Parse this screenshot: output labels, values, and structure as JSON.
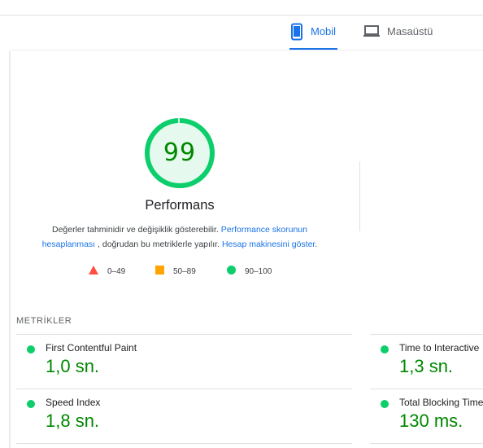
{
  "tabs": [
    {
      "label": "Mobil",
      "icon": "smartphone-icon",
      "selected": true
    },
    {
      "label": "Masaüstü",
      "icon": "laptop-icon",
      "selected": false
    }
  ],
  "score": {
    "value": "99",
    "fraction": 0.99,
    "title": "Performans",
    "description_text_1": "Değerler tahminidir ve değişiklik gösterebilir.",
    "link_score_calc_1": "Performance skorunun",
    "link_score_calc_2": "hesaplanması",
    "description_text_2": ", doğrudan bu metriklerle yapılır.",
    "link_calculator": "Hesap makinesini göster",
    "description_text_3": "."
  },
  "legend": {
    "fail": "0–49",
    "average": "50–89",
    "pass": "90–100"
  },
  "metrics_section": {
    "label": "METRİKLER",
    "items": [
      {
        "name": "First Contentful Paint",
        "value": "1,0 sn."
      },
      {
        "name": "Time to Interactive",
        "value": "1,3 sn."
      },
      {
        "name": "Speed Index",
        "value": "1,8 sn."
      },
      {
        "name": "Total Blocking Time",
        "value": "130 ms."
      }
    ]
  },
  "colors": {
    "accent": "#1a73e8",
    "pass": "#0cce6b",
    "pass_text": "#008800",
    "average": "#ffa400",
    "fail": "#ff4e42"
  }
}
